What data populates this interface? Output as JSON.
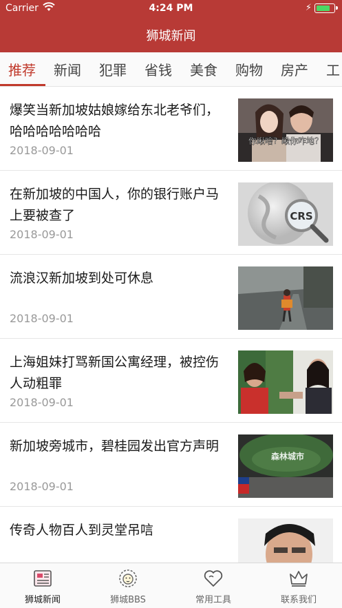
{
  "status_bar": {
    "carrier": "Carrier",
    "time": "4:24 PM",
    "battery_level": 0.85
  },
  "nav": {
    "title": "狮城新闻"
  },
  "tabs": [
    {
      "label": "推荐",
      "active": true
    },
    {
      "label": "新闻"
    },
    {
      "label": "犯罪"
    },
    {
      "label": "省钱"
    },
    {
      "label": "美食"
    },
    {
      "label": "购物"
    },
    {
      "label": "房产"
    },
    {
      "label": "工"
    }
  ],
  "articles": [
    {
      "title": "爆笑当新加坡姑娘嫁给东北老爷们，哈哈哈哈哈哈哈",
      "date": "2018-09-01",
      "thumb_caption": "你瞅啥？瞅你咋地？"
    },
    {
      "title": "在新加坡的中国人，你的银行账户马上要被查了",
      "date": "2018-09-01",
      "thumb_caption": "CRS"
    },
    {
      "title": "流浪汉新加坡到处可休息",
      "date": "2018-09-01"
    },
    {
      "title": "上海姐妹打骂新国公寓经理，被控伤人动粗罪",
      "date": "2018-09-01"
    },
    {
      "title": "新加坡旁城市，碧桂园发出官方声明",
      "date": "2018-09-01",
      "thumb_caption": "森林城市"
    },
    {
      "title": "传奇人物百人到灵堂吊唁",
      "date": ""
    }
  ],
  "tabbar": [
    {
      "label": "狮城新闻",
      "icon": "news-icon",
      "active": true
    },
    {
      "label": "狮城BBS",
      "icon": "lion-icon"
    },
    {
      "label": "常用工具",
      "icon": "heart-icon"
    },
    {
      "label": "联系我们",
      "icon": "crown-icon"
    }
  ],
  "colors": {
    "brand": "#b83a36",
    "tab_active": "#c0392b",
    "battery": "#4cd964"
  }
}
